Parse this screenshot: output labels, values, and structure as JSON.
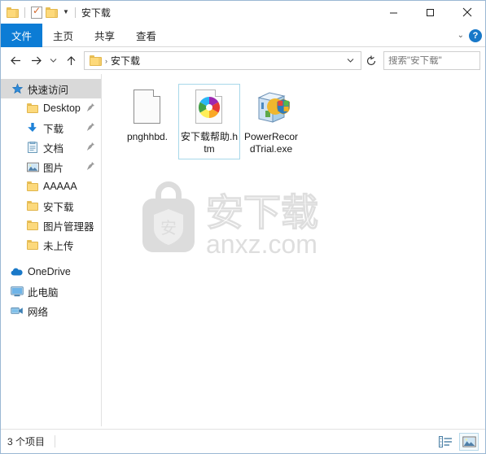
{
  "window": {
    "title": "安下载",
    "controls": {
      "minimize": "—",
      "maximize": "▢",
      "close": "✕"
    },
    "quick_access_toolbar": [
      {
        "name": "folder-icon",
        "label": ""
      },
      {
        "name": "properties-icon",
        "label": ""
      },
      {
        "name": "new-folder-icon",
        "label": ""
      },
      {
        "name": "chevron-down-icon",
        "label": "▾"
      }
    ]
  },
  "ribbon": {
    "tabs": [
      {
        "label": "文件",
        "active": true
      },
      {
        "label": "主页",
        "active": false
      },
      {
        "label": "共享",
        "active": false
      },
      {
        "label": "查看",
        "active": false
      }
    ],
    "collapse_icon": "⌄",
    "help_icon": "?"
  },
  "addressbar": {
    "back": "←",
    "forward": "→",
    "recent": "⌄",
    "up": "↑",
    "breadcrumb_separator": "›",
    "breadcrumb_label": "安下载",
    "dropdown": "⌄",
    "refresh": "↻"
  },
  "search": {
    "placeholder": "搜索\"安下载\"",
    "value": "",
    "icon": "search-icon"
  },
  "sidebar": {
    "items": [
      {
        "label": "快速访问",
        "icon": "star-pin-icon",
        "indent": "root",
        "selected": true,
        "pinned": false
      },
      {
        "label": "Desktop",
        "icon": "folder-icon",
        "indent": "1",
        "selected": false,
        "pinned": true
      },
      {
        "label": "下载",
        "icon": "download-icon",
        "indent": "1",
        "selected": false,
        "pinned": true
      },
      {
        "label": "文档",
        "icon": "documents-icon",
        "indent": "1",
        "selected": false,
        "pinned": true
      },
      {
        "label": "图片",
        "icon": "pictures-icon",
        "indent": "1",
        "selected": false,
        "pinned": true
      },
      {
        "label": "AAAAA",
        "icon": "folder-icon",
        "indent": "1",
        "selected": false,
        "pinned": false
      },
      {
        "label": "安下载",
        "icon": "folder-icon",
        "indent": "1",
        "selected": false,
        "pinned": false
      },
      {
        "label": "图片管理器",
        "icon": "folder-icon",
        "indent": "1",
        "selected": false,
        "pinned": false
      },
      {
        "label": "未上传",
        "icon": "folder-icon",
        "indent": "1",
        "selected": false,
        "pinned": false
      },
      {
        "label": "OneDrive",
        "icon": "onedrive-cloud-icon",
        "indent": "root",
        "selected": false,
        "pinned": false
      },
      {
        "label": "此电脑",
        "icon": "this-pc-icon",
        "indent": "root",
        "selected": false,
        "pinned": false
      },
      {
        "label": "网络",
        "icon": "network-icon",
        "indent": "root",
        "selected": false,
        "pinned": false
      }
    ]
  },
  "files": [
    {
      "name": "pnghhbd.",
      "icon": "blank-document-icon",
      "selected": false
    },
    {
      "name": "安下载帮助.htm",
      "icon": "html-document-icon",
      "selected": true
    },
    {
      "name": "PowerRecordTrial.exe",
      "icon": "installer-shield-icon",
      "selected": false
    }
  ],
  "watermark": {
    "text_cn": "安下载",
    "text_url": "anxz.com",
    "logo": "shopping-bag-shield-logo"
  },
  "statusbar": {
    "item_count": "3 个项目",
    "view_details_icon": "details-view-icon",
    "view_large_icons_icon": "large-icons-view-icon"
  },
  "colors": {
    "accent": "#0c7cd5",
    "folder_yellow": "#fcd97c",
    "selection_border": "#a8d8ea",
    "sidebar_selected": "#d9d9d9",
    "window_border": "#9bb8d4",
    "watermark_gray": "#dedede"
  }
}
